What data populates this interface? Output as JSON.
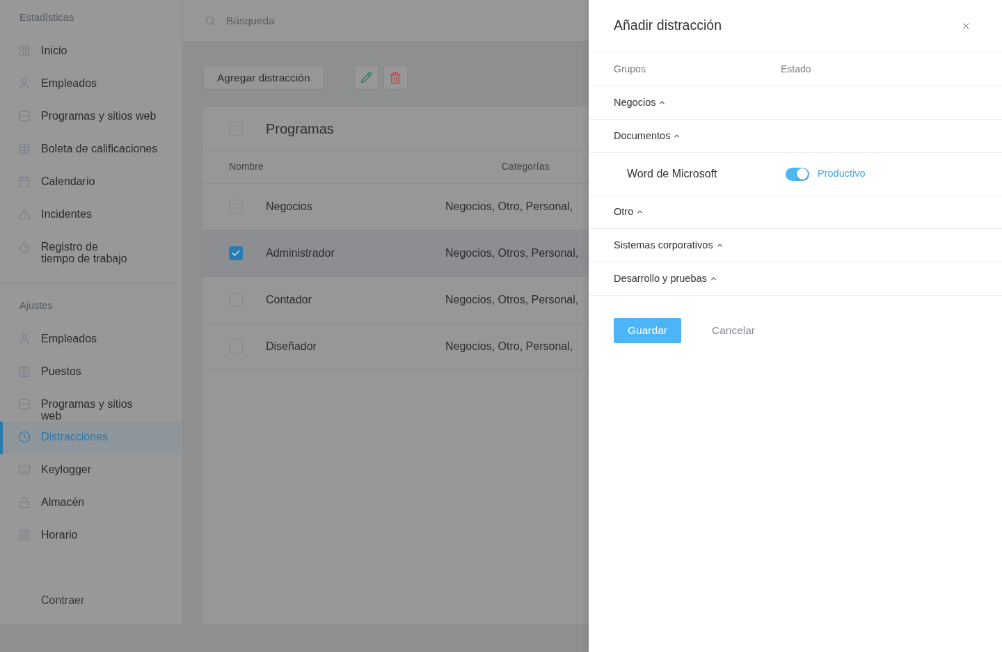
{
  "sidebar": {
    "sections": [
      {
        "title": "Estadísticas",
        "items": [
          {
            "label": "Inicio",
            "selected": false
          },
          {
            "label": "Empleados",
            "selected": false
          },
          {
            "label": "Programas y sitios web",
            "selected": false
          },
          {
            "label": "Boleta de calificaciones",
            "selected": false
          },
          {
            "label": "Calendario",
            "selected": false
          },
          {
            "label": "Incidentes",
            "selected": false
          },
          {
            "label": "Registro de\ntiempo de trabajo",
            "selected": false
          }
        ]
      },
      {
        "title": "Ajustes",
        "items": [
          {
            "label": "Empleados",
            "selected": false
          },
          {
            "label": "Puestos",
            "selected": false
          },
          {
            "label": "Programas y sitios\nweb",
            "selected": false
          },
          {
            "label": "Distracciones",
            "selected": true
          },
          {
            "label": "Keylogger",
            "selected": false
          },
          {
            "label": "Almacén",
            "selected": false
          },
          {
            "label": "Horario",
            "selected": false
          }
        ]
      }
    ],
    "collapse": "Contraer"
  },
  "search": {
    "placeholder": "Búsqueda"
  },
  "toolbar": {
    "add_button": "Agregar distracción"
  },
  "table": {
    "title": "Programas",
    "header_checked": false,
    "columns": [
      "Nombre",
      "Categorías"
    ],
    "rows": [
      {
        "name": "Negocios",
        "categories": "Negocios, Otro, Personal,",
        "checked": false
      },
      {
        "name": "Administrador",
        "categories": "Negocios, Otros, Personal,",
        "checked": true
      },
      {
        "name": "Contador",
        "categories": "Negocios, Otros, Personal,",
        "checked": false
      },
      {
        "name": "Diseñador",
        "categories": "Negocios, Otro, Personal,",
        "checked": false
      }
    ]
  },
  "drawer": {
    "title": "Añadir distracción",
    "columns": [
      "Grupos",
      "Estado"
    ],
    "groups": [
      {
        "name": "Negocios"
      },
      {
        "name": "Documentos",
        "items": [
          {
            "name": "Word de Microsoft",
            "on": true,
            "status": "Productivo"
          }
        ]
      },
      {
        "name": "Otro"
      },
      {
        "name": "Sistemas corporativos"
      },
      {
        "name": "Desarrollo y pruebas"
      }
    ],
    "save_button": "Guardar",
    "cancel_button": "Cancelar"
  }
}
